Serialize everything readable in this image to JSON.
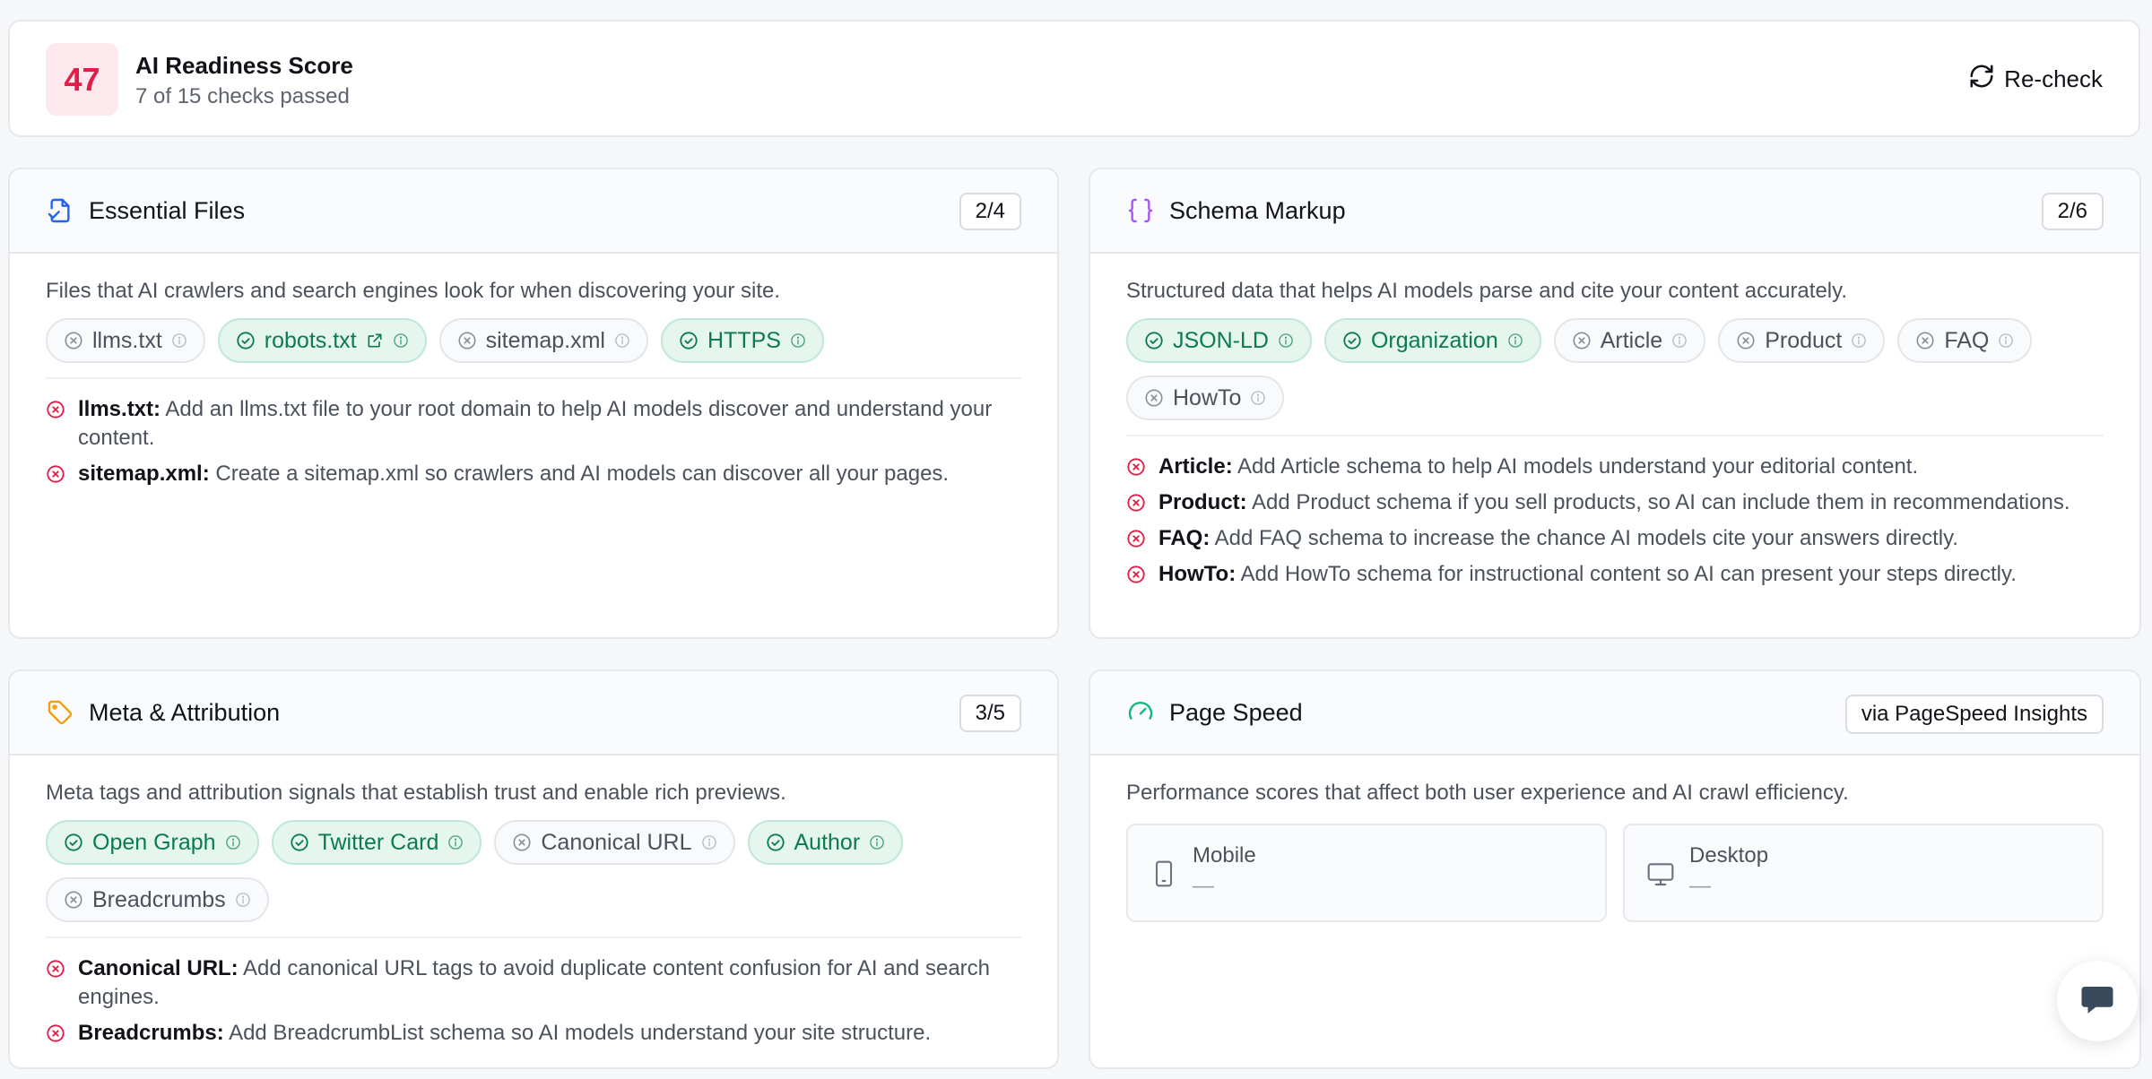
{
  "score": {
    "value": "47",
    "title": "AI Readiness Score",
    "subtitle": "7 of 15 checks passed",
    "recheck_label": "Re-check"
  },
  "colors": {
    "score_accent": "#e11d48",
    "pass": "#0d7a4f",
    "fail": "#e11d48",
    "essential_icon": "#2563eb",
    "schema_icon": "#a855f7",
    "meta_icon": "#f59e0b",
    "speed_icon": "#10b981"
  },
  "essential": {
    "title": "Essential Files",
    "icon": "file-check-icon",
    "count": "2/4",
    "description": "Files that AI crawlers and search engines look for when discovering your site.",
    "chips": [
      {
        "label": "llms.txt",
        "status": "fail"
      },
      {
        "label": "robots.txt",
        "status": "pass",
        "external": true
      },
      {
        "label": "sitemap.xml",
        "status": "fail"
      },
      {
        "label": "HTTPS",
        "status": "pass"
      }
    ],
    "issues": [
      {
        "name": "llms.txt:",
        "text": "Add an llms.txt file to your root domain to help AI models discover and understand your content."
      },
      {
        "name": "sitemap.xml:",
        "text": "Create a sitemap.xml so crawlers and AI models can discover all your pages."
      }
    ]
  },
  "schema": {
    "title": "Schema Markup",
    "icon": "braces-icon",
    "count": "2/6",
    "description": "Structured data that helps AI models parse and cite your content accurately.",
    "chips": [
      {
        "label": "JSON-LD",
        "status": "pass"
      },
      {
        "label": "Organization",
        "status": "pass"
      },
      {
        "label": "Article",
        "status": "fail"
      },
      {
        "label": "Product",
        "status": "fail"
      },
      {
        "label": "FAQ",
        "status": "fail"
      },
      {
        "label": "HowTo",
        "status": "fail"
      }
    ],
    "issues": [
      {
        "name": "Article:",
        "text": "Add Article schema to help AI models understand your editorial content."
      },
      {
        "name": "Product:",
        "text": "Add Product schema if you sell products, so AI can include them in recommendations."
      },
      {
        "name": "FAQ:",
        "text": "Add FAQ schema to increase the chance AI models cite your answers directly."
      },
      {
        "name": "HowTo:",
        "text": "Add HowTo schema for instructional content so AI can present your steps directly."
      }
    ]
  },
  "meta": {
    "title": "Meta & Attribution",
    "icon": "tag-icon",
    "count": "3/5",
    "description": "Meta tags and attribution signals that establish trust and enable rich previews.",
    "chips": [
      {
        "label": "Open Graph",
        "status": "pass"
      },
      {
        "label": "Twitter Card",
        "status": "pass"
      },
      {
        "label": "Canonical URL",
        "status": "fail"
      },
      {
        "label": "Author",
        "status": "pass"
      },
      {
        "label": "Breadcrumbs",
        "status": "fail"
      }
    ],
    "issues": [
      {
        "name": "Canonical URL:",
        "text": "Add canonical URL tags to avoid duplicate content confusion for AI and search engines."
      },
      {
        "name": "Breadcrumbs:",
        "text": "Add BreadcrumbList schema so AI models understand your site structure."
      }
    ]
  },
  "speed": {
    "title": "Page Speed",
    "icon": "gauge-icon",
    "source": "via PageSpeed Insights",
    "description": "Performance scores that affect both user experience and AI crawl efficiency.",
    "mobile": {
      "label": "Mobile",
      "value": "—",
      "icon": "smartphone-icon"
    },
    "desktop": {
      "label": "Desktop",
      "value": "—",
      "icon": "monitor-icon"
    }
  },
  "chat": {
    "icon": "chat-bubble-icon"
  }
}
